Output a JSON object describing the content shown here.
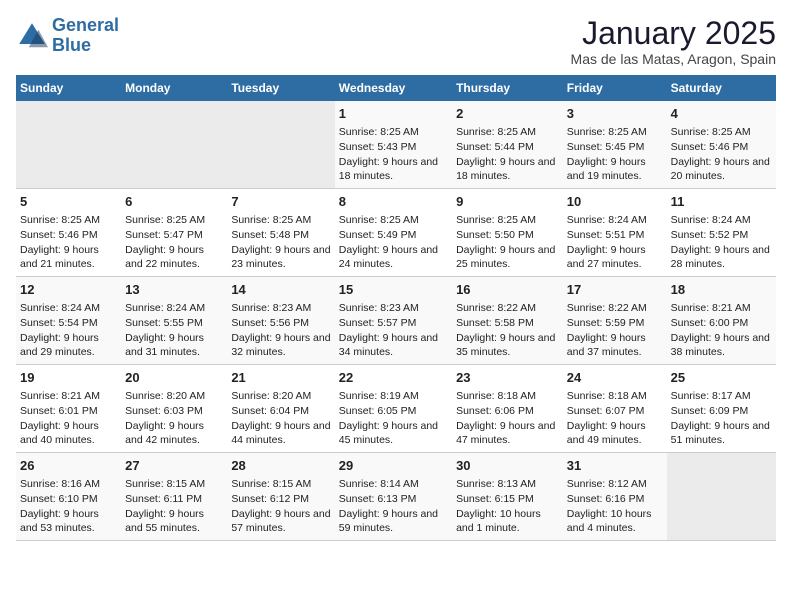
{
  "logo": {
    "line1": "General",
    "line2": "Blue"
  },
  "title": "January 2025",
  "subtitle": "Mas de las Matas, Aragon, Spain",
  "days_of_week": [
    "Sunday",
    "Monday",
    "Tuesday",
    "Wednesday",
    "Thursday",
    "Friday",
    "Saturday"
  ],
  "weeks": [
    [
      {
        "day": "",
        "empty": true
      },
      {
        "day": "",
        "empty": true
      },
      {
        "day": "",
        "empty": true
      },
      {
        "day": "1",
        "sunrise": "8:25 AM",
        "sunset": "5:43 PM",
        "daylight": "9 hours and 18 minutes."
      },
      {
        "day": "2",
        "sunrise": "8:25 AM",
        "sunset": "5:44 PM",
        "daylight": "9 hours and 18 minutes."
      },
      {
        "day": "3",
        "sunrise": "8:25 AM",
        "sunset": "5:45 PM",
        "daylight": "9 hours and 19 minutes."
      },
      {
        "day": "4",
        "sunrise": "8:25 AM",
        "sunset": "5:46 PM",
        "daylight": "9 hours and 20 minutes."
      }
    ],
    [
      {
        "day": "5",
        "sunrise": "8:25 AM",
        "sunset": "5:46 PM",
        "daylight": "9 hours and 21 minutes."
      },
      {
        "day": "6",
        "sunrise": "8:25 AM",
        "sunset": "5:47 PM",
        "daylight": "9 hours and 22 minutes."
      },
      {
        "day": "7",
        "sunrise": "8:25 AM",
        "sunset": "5:48 PM",
        "daylight": "9 hours and 23 minutes."
      },
      {
        "day": "8",
        "sunrise": "8:25 AM",
        "sunset": "5:49 PM",
        "daylight": "9 hours and 24 minutes."
      },
      {
        "day": "9",
        "sunrise": "8:25 AM",
        "sunset": "5:50 PM",
        "daylight": "9 hours and 25 minutes."
      },
      {
        "day": "10",
        "sunrise": "8:24 AM",
        "sunset": "5:51 PM",
        "daylight": "9 hours and 27 minutes."
      },
      {
        "day": "11",
        "sunrise": "8:24 AM",
        "sunset": "5:52 PM",
        "daylight": "9 hours and 28 minutes."
      }
    ],
    [
      {
        "day": "12",
        "sunrise": "8:24 AM",
        "sunset": "5:54 PM",
        "daylight": "9 hours and 29 minutes."
      },
      {
        "day": "13",
        "sunrise": "8:24 AM",
        "sunset": "5:55 PM",
        "daylight": "9 hours and 31 minutes."
      },
      {
        "day": "14",
        "sunrise": "8:23 AM",
        "sunset": "5:56 PM",
        "daylight": "9 hours and 32 minutes."
      },
      {
        "day": "15",
        "sunrise": "8:23 AM",
        "sunset": "5:57 PM",
        "daylight": "9 hours and 34 minutes."
      },
      {
        "day": "16",
        "sunrise": "8:22 AM",
        "sunset": "5:58 PM",
        "daylight": "9 hours and 35 minutes."
      },
      {
        "day": "17",
        "sunrise": "8:22 AM",
        "sunset": "5:59 PM",
        "daylight": "9 hours and 37 minutes."
      },
      {
        "day": "18",
        "sunrise": "8:21 AM",
        "sunset": "6:00 PM",
        "daylight": "9 hours and 38 minutes."
      }
    ],
    [
      {
        "day": "19",
        "sunrise": "8:21 AM",
        "sunset": "6:01 PM",
        "daylight": "9 hours and 40 minutes."
      },
      {
        "day": "20",
        "sunrise": "8:20 AM",
        "sunset": "6:03 PM",
        "daylight": "9 hours and 42 minutes."
      },
      {
        "day": "21",
        "sunrise": "8:20 AM",
        "sunset": "6:04 PM",
        "daylight": "9 hours and 44 minutes."
      },
      {
        "day": "22",
        "sunrise": "8:19 AM",
        "sunset": "6:05 PM",
        "daylight": "9 hours and 45 minutes."
      },
      {
        "day": "23",
        "sunrise": "8:18 AM",
        "sunset": "6:06 PM",
        "daylight": "9 hours and 47 minutes."
      },
      {
        "day": "24",
        "sunrise": "8:18 AM",
        "sunset": "6:07 PM",
        "daylight": "9 hours and 49 minutes."
      },
      {
        "day": "25",
        "sunrise": "8:17 AM",
        "sunset": "6:09 PM",
        "daylight": "9 hours and 51 minutes."
      }
    ],
    [
      {
        "day": "26",
        "sunrise": "8:16 AM",
        "sunset": "6:10 PM",
        "daylight": "9 hours and 53 minutes."
      },
      {
        "day": "27",
        "sunrise": "8:15 AM",
        "sunset": "6:11 PM",
        "daylight": "9 hours and 55 minutes."
      },
      {
        "day": "28",
        "sunrise": "8:15 AM",
        "sunset": "6:12 PM",
        "daylight": "9 hours and 57 minutes."
      },
      {
        "day": "29",
        "sunrise": "8:14 AM",
        "sunset": "6:13 PM",
        "daylight": "9 hours and 59 minutes."
      },
      {
        "day": "30",
        "sunrise": "8:13 AM",
        "sunset": "6:15 PM",
        "daylight": "10 hours and 1 minute."
      },
      {
        "day": "31",
        "sunrise": "8:12 AM",
        "sunset": "6:16 PM",
        "daylight": "10 hours and 4 minutes."
      },
      {
        "day": "",
        "empty": true
      }
    ]
  ]
}
